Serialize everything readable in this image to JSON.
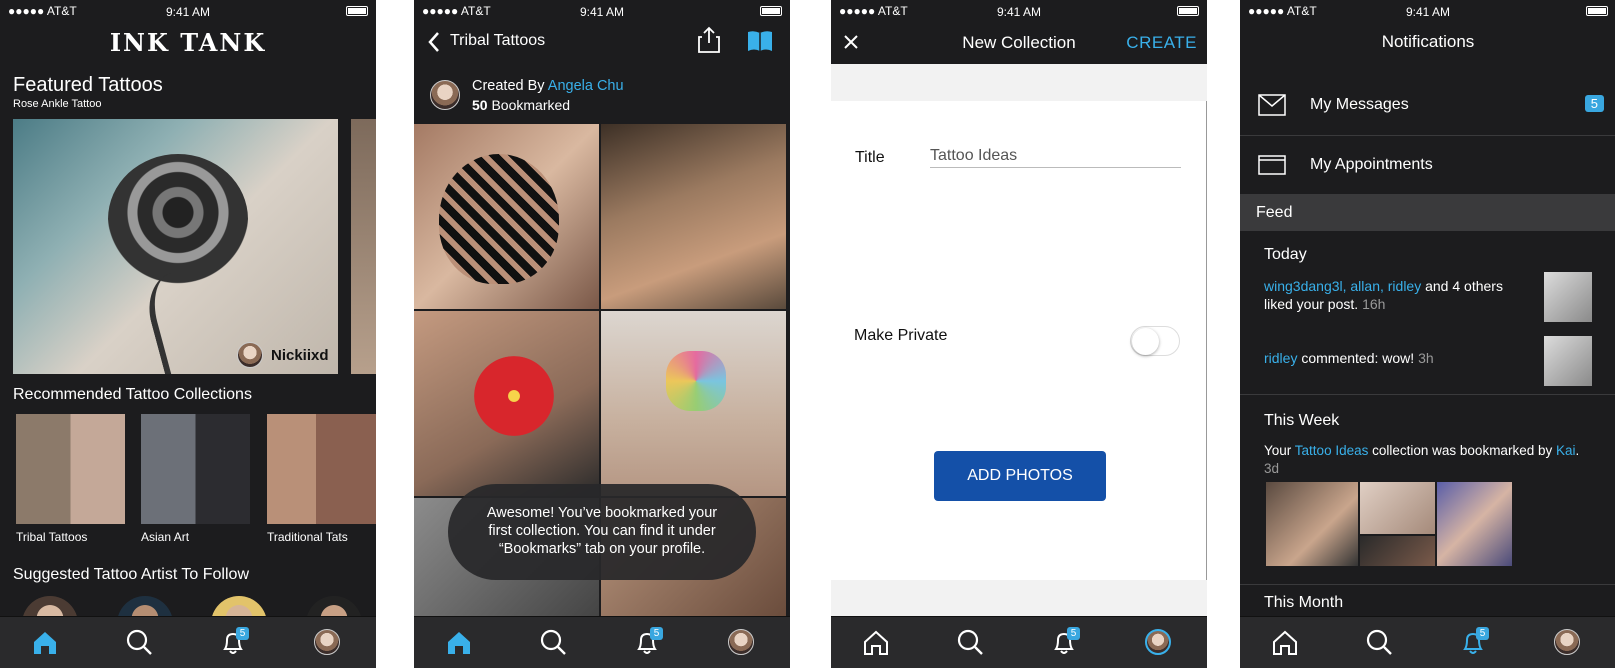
{
  "status_bar": {
    "carrier": "●●●●● AT&T",
    "time": "9:41 AM"
  },
  "tabbar": {
    "badge": "5",
    "icons": [
      "home-icon",
      "search-icon",
      "bell-icon",
      "profile-icon"
    ]
  },
  "screen1": {
    "logo": "INK TANK",
    "featured_title": "Featured Tattoos",
    "featured_subtitle": "Rose Ankle Tattoo",
    "featured_artist": "Nickiixd",
    "recommended_title": "Recommended Tattoo Collections",
    "collections": [
      {
        "label": "Tribal Tattoos"
      },
      {
        "label": "Asian Art"
      },
      {
        "label": "Traditional Tats"
      }
    ],
    "suggested_title": "Suggested Tattoo Artist To Follow"
  },
  "screen2": {
    "title": "Tribal Tattoos",
    "created_by_prefix": "Created By",
    "creator": "Angela Chu",
    "bookmark_count": "50",
    "bookmark_label": "Bookmarked",
    "toast": "Awesome! You’ve bookmarked your first collection. You can find it under “Bookmarks” tab on your profile."
  },
  "screen3": {
    "title": "New Collection",
    "create": "CREATE",
    "title_label": "Title",
    "title_value": "Tattoo Ideas",
    "private_label": "Make Private",
    "add_photos": "ADD PHOTOS"
  },
  "screen4": {
    "title": "Notifications",
    "messages_label": "My Messages",
    "messages_badge": "5",
    "appointments_label": "My Appointments",
    "feed_header": "Feed",
    "today": "Today",
    "notif1_users": "wing3dang3l, allan, ridley",
    "notif1_text": "and 4 others liked your post.",
    "notif1_time": "16h",
    "notif2_user": "ridley",
    "notif2_text": "commented: wow!",
    "notif2_time": "3h",
    "this_week": "This Week",
    "week_prefix": "Your",
    "week_collection": "Tattoo Ideas",
    "week_mid": "collection was bookmarked by",
    "week_user": "Kai",
    "week_suffix": ".",
    "week_time": "3d",
    "this_month": "This Month"
  },
  "colors": {
    "accent": "#39b0ea",
    "button": "#1450a8",
    "dark": "#1c1c1e"
  }
}
